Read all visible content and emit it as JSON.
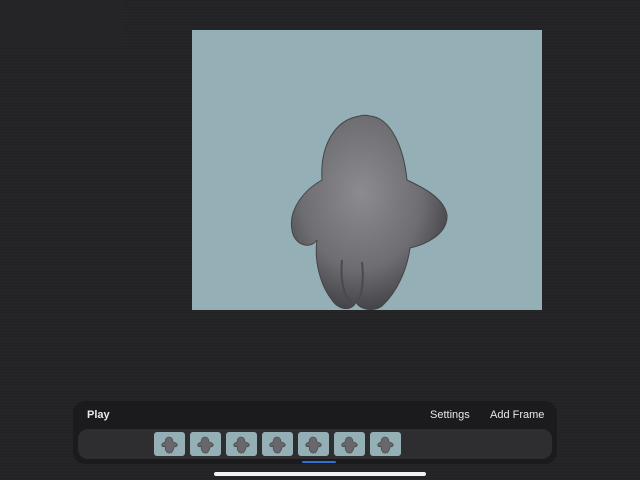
{
  "toolbar": {
    "play_label": "Play",
    "settings_label": "Settings",
    "add_frame_label": "Add Frame"
  },
  "colors": {
    "background": "#232325",
    "canvas": "#94afb5",
    "toolbar": "#1b1b1d",
    "frame_track": "#2e2e31",
    "selection": "#2f6fd6",
    "figure": "#6e6e72"
  },
  "timeline": {
    "frames": [
      {
        "icon": "figure-thumbnail-icon",
        "selected": false
      },
      {
        "icon": "figure-thumbnail-icon",
        "selected": false
      },
      {
        "icon": "figure-thumbnail-icon",
        "selected": false
      },
      {
        "icon": "figure-thumbnail-icon",
        "selected": false
      },
      {
        "icon": "figure-thumbnail-icon",
        "selected": true
      },
      {
        "icon": "figure-thumbnail-icon",
        "selected": false
      },
      {
        "icon": "figure-thumbnail-icon",
        "selected": false
      }
    ]
  }
}
